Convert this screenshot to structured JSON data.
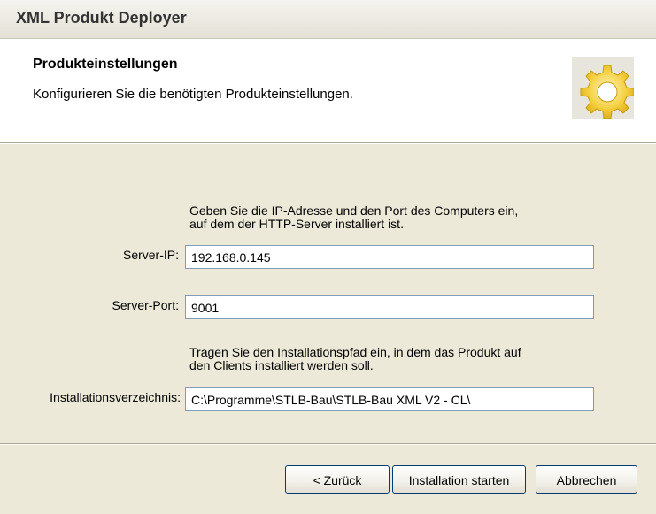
{
  "window": {
    "title": "XML Produkt Deployer"
  },
  "header": {
    "title": "Produkteinstellungen",
    "subtitle": "Konfigurieren Sie die benötigten Produkteinstellungen.",
    "icon": "gear-icon"
  },
  "server_hint": {
    "line1": "Geben Sie die IP-Adresse und den Port des Computers ein,",
    "line2": "auf dem der HTTP-Server installiert ist."
  },
  "fields": {
    "server_ip": {
      "label": "Server-IP:",
      "value": "192.168.0.145"
    },
    "server_port": {
      "label": "Server-Port:",
      "value": "9001"
    },
    "install_dir": {
      "label": "Installationsverzeichnis:",
      "value": "C:\\Programme\\STLB-Bau\\STLB-Bau XML V2 - CL\\"
    }
  },
  "install_hint": {
    "line1": "Tragen Sie den Installationspfad ein, in dem das Produkt auf",
    "line2": "den Clients installiert werden soll."
  },
  "buttons": {
    "back": "< Zurück",
    "start": "Installation starten",
    "cancel": "Abbrechen"
  },
  "colors": {
    "dialog_bg": "#ece9d8",
    "field_border": "#7f9db9",
    "button_border": "#003c74",
    "gear": "#f2c230"
  }
}
